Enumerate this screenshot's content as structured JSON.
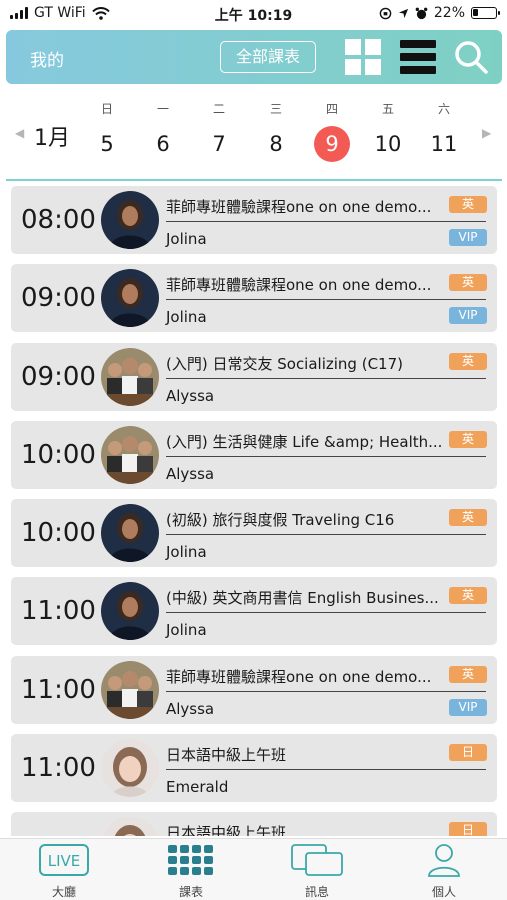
{
  "status": {
    "carrier": "GT WiFi",
    "time": "上午 10:19",
    "battery": "22%"
  },
  "header": {
    "mine": "我的",
    "all_courses": "全部課表"
  },
  "week": {
    "month": "1月",
    "days": [
      {
        "weekday": "日",
        "date": "5"
      },
      {
        "weekday": "一",
        "date": "6"
      },
      {
        "weekday": "二",
        "date": "7"
      },
      {
        "weekday": "三",
        "date": "8"
      },
      {
        "weekday": "四",
        "date": "9"
      },
      {
        "weekday": "五",
        "date": "10"
      },
      {
        "weekday": "六",
        "date": "11"
      }
    ],
    "selected": "9"
  },
  "classes": [
    {
      "time": "08:00",
      "title": "菲師專班體驗課程one on one demo...",
      "teacher": "Jolina",
      "lang": "英",
      "vip": "VIP",
      "avatar": "teacher-jolina"
    },
    {
      "time": "09:00",
      "title": "菲師專班體驗課程one on one demo...",
      "teacher": "Jolina",
      "lang": "英",
      "vip": "VIP",
      "avatar": "teacher-jolina"
    },
    {
      "time": "09:00",
      "title": "(入門) 日常交友 Socializing (C17)",
      "teacher": "Alyssa",
      "lang": "英",
      "avatar": "teacher-alyssa"
    },
    {
      "time": "10:00",
      "title": "(入門) 生活與健康 Life &amp; Health...",
      "teacher": "Alyssa",
      "lang": "英",
      "avatar": "teacher-alyssa"
    },
    {
      "time": "10:00",
      "title": "(初級) 旅行與度假 Traveling C16",
      "teacher": "Jolina",
      "lang": "英",
      "avatar": "teacher-jolina"
    },
    {
      "time": "11:00",
      "title": "(中級) 英文商用書信 English Busines...",
      "teacher": "Jolina",
      "lang": "英",
      "avatar": "teacher-jolina"
    },
    {
      "time": "11:00",
      "title": "菲師專班體驗課程one on one demo...",
      "teacher": "Alyssa",
      "lang": "英",
      "vip": "VIP",
      "avatar": "teacher-alyssa"
    },
    {
      "time": "11:00",
      "title": "日本語中級上午班",
      "teacher": "Emerald",
      "lang": "日",
      "avatar": "teacher-emerald"
    },
    {
      "time": "",
      "title": "日本語中級上午班",
      "teacher": "",
      "lang": "日",
      "avatar": "teacher-emerald"
    }
  ],
  "tabs": [
    {
      "icon": "live-icon",
      "icon_text": "LIVE",
      "label": "大廳"
    },
    {
      "icon": "schedule-icon",
      "label": "課表"
    },
    {
      "icon": "messages-icon",
      "label": "訊息"
    },
    {
      "icon": "person-icon",
      "label": "個人"
    }
  ],
  "colors": {
    "header_start": "#86c9de",
    "header_end": "#7fd0c4",
    "selected_day": "#f25a53",
    "lang_tag": "#f0a25b",
    "vip_tag": "#79b4dd",
    "tab_accent": "#3aa8a8"
  }
}
